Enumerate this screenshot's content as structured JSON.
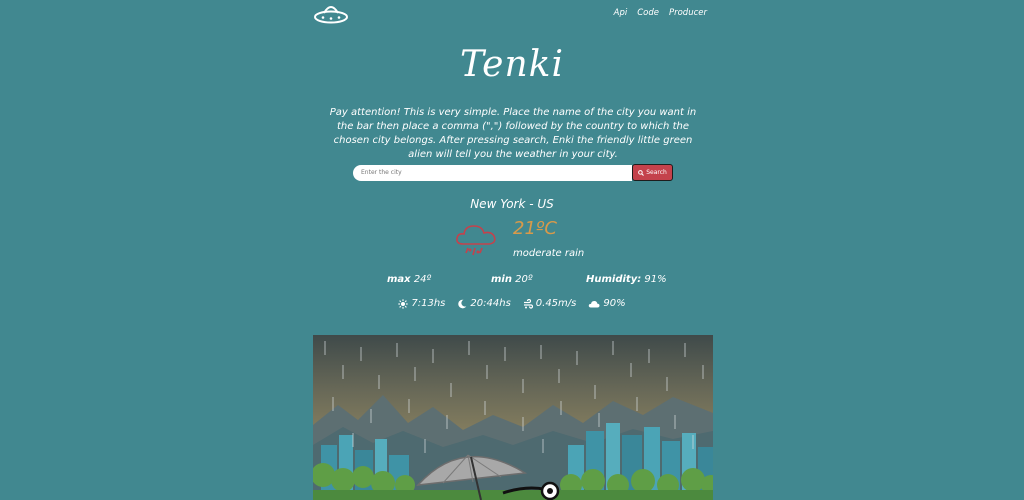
{
  "nav": {
    "logo_icon": "ufo-icon",
    "links": [
      "Api",
      "Code",
      "Producer"
    ]
  },
  "title": "Tenki",
  "intro": "Pay attention! This is very simple. Place the name of the city you want in the bar then place a comma (\",\") followed by the country to which the chosen city belongs. After pressing search, Enki the friendly little green alien will tell you the weather in your city.",
  "search": {
    "placeholder": "Enter the city",
    "value": "",
    "button_label": "Search",
    "button_icon": "search-icon"
  },
  "weather": {
    "city": "New York - US",
    "icon": "rain-cloud-icon",
    "temperature": "21ºC",
    "description": "moderate rain",
    "max_label": "max",
    "max_value": "24º",
    "min_label": "min",
    "min_value": "20º",
    "humidity_label": "Humidity:",
    "humidity_value": "91%",
    "sunrise": "7:13hs",
    "sunset": "20:44hs",
    "wind": "0.45m/s",
    "clouds": "90%"
  },
  "colors": {
    "background": "#418890",
    "search_button": "#c4424c",
    "temperature": "#d89a4a",
    "rain_icon": "#c4424c"
  }
}
